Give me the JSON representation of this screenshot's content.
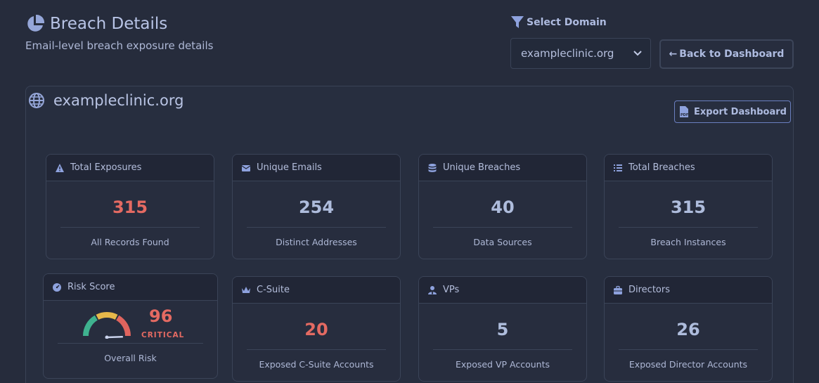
{
  "header": {
    "title": "Breach Details",
    "subtitle": "Email-level breach exposure details",
    "title_icon": "pie-chart-icon"
  },
  "domain_selector": {
    "label": "Select Domain",
    "selected": "exampleclinic.org",
    "icon": "filter-icon"
  },
  "back_button": {
    "arrow": "←",
    "label": "Back to Dashboard"
  },
  "panel": {
    "domain": "exampleclinic.org",
    "export_label": "Export Dashboard"
  },
  "stats": [
    {
      "label": "Total Exposures",
      "value": "315",
      "caption": "All Records Found",
      "icon": "warning-triangle-icon",
      "highlight": true
    },
    {
      "label": "Unique Emails",
      "value": "254",
      "caption": "Distinct Addresses",
      "icon": "envelope-icon",
      "highlight": false
    },
    {
      "label": "Unique Breaches",
      "value": "40",
      "caption": "Data Sources",
      "icon": "database-icon",
      "highlight": false
    },
    {
      "label": "Total Breaches",
      "value": "315",
      "caption": "Breach Instances",
      "icon": "list-icon",
      "highlight": false
    }
  ],
  "risk": {
    "label": "Risk Score",
    "value": "96",
    "level": "CRITICAL",
    "caption": "Overall Risk",
    "score_fraction": 0.96
  },
  "roles": [
    {
      "label": "C-Suite",
      "value": "20",
      "caption": "Exposed C-Suite Accounts",
      "icon": "crown-icon",
      "highlight": true
    },
    {
      "label": "VPs",
      "value": "5",
      "caption": "Exposed VP Accounts",
      "icon": "user-tie-icon",
      "highlight": false
    },
    {
      "label": "Directors",
      "value": "26",
      "caption": "Exposed Director Accounts",
      "icon": "briefcase-icon",
      "highlight": false
    }
  ],
  "colors": {
    "background": "#262c3c",
    "danger": "#e46a62",
    "accent": "#7b8fd0",
    "gauge_green": "#3fb28f",
    "gauge_yellow": "#e7b84a",
    "gauge_red": "#e0645e"
  }
}
